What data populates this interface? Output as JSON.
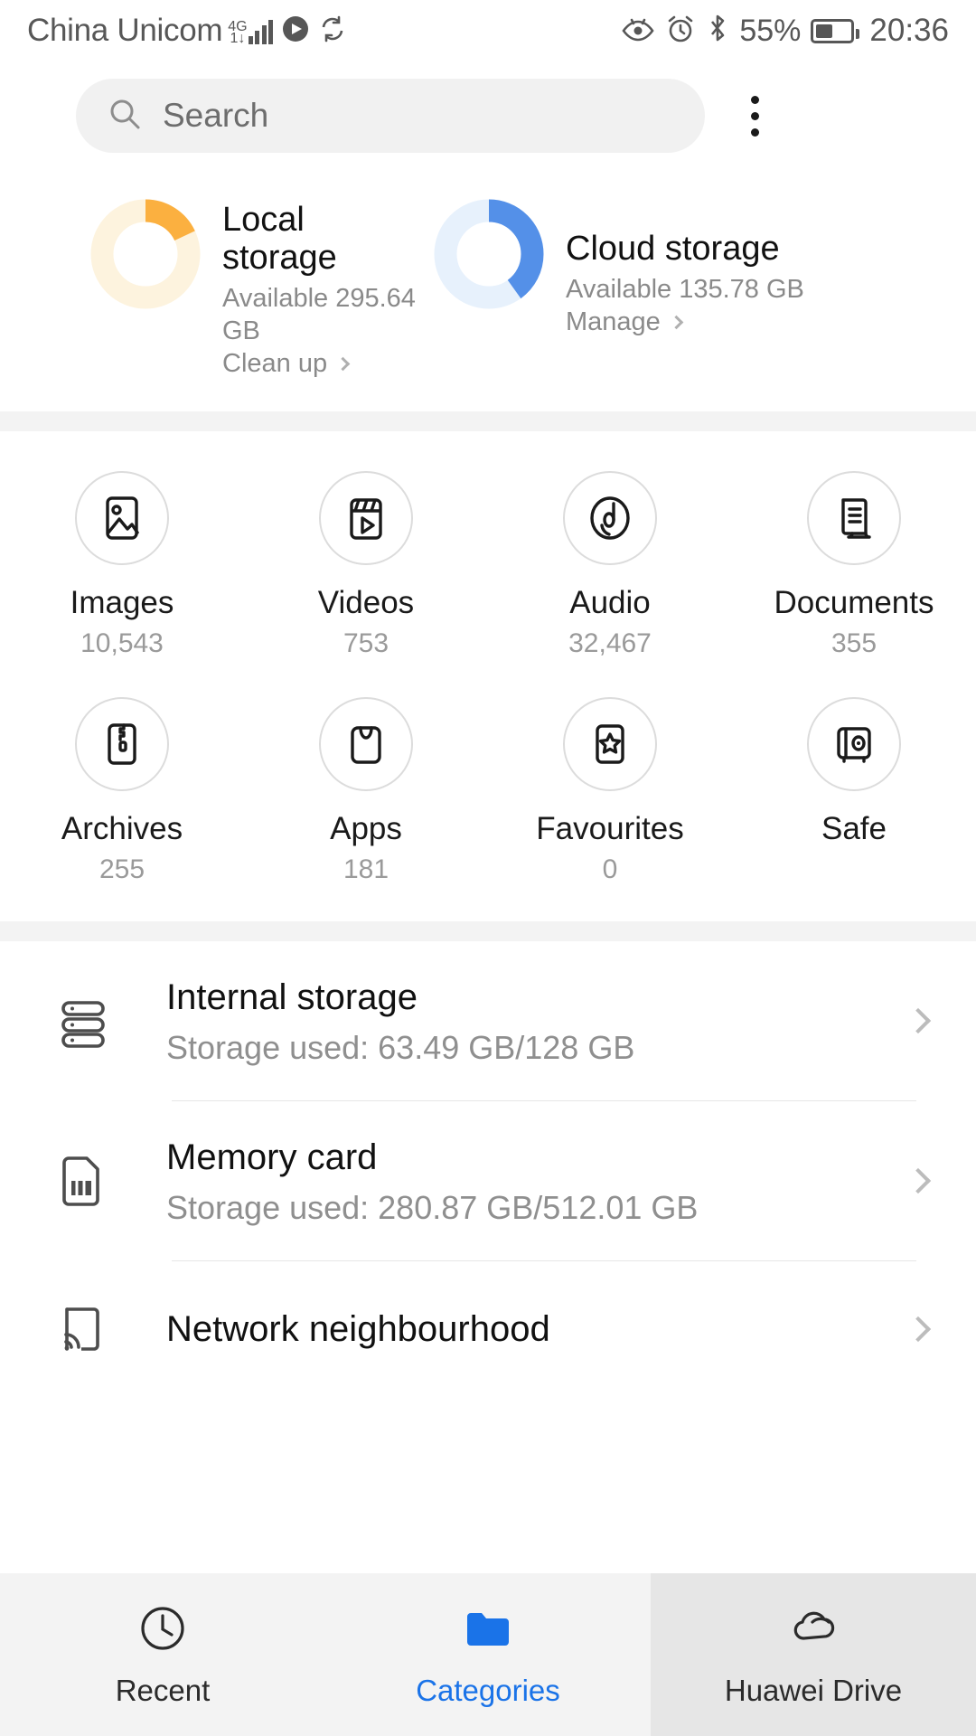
{
  "status_bar": {
    "carrier": "China Unicom",
    "network_gen": {
      "top": "4G",
      "bottom": "1↓"
    },
    "signal_bars": 4,
    "icons": [
      "play-badge-icon",
      "sync-icon",
      "eye-comfort-icon",
      "alarm-icon",
      "bluetooth-icon"
    ],
    "battery_percent": "55%",
    "battery_level": 55,
    "time": "20:36"
  },
  "search": {
    "placeholder": "Search",
    "icon": "search-icon"
  },
  "overflow_menu": {
    "icon": "more-vertical-icon"
  },
  "storage_summary": {
    "local": {
      "title": "Local storage",
      "available": "Available 295.64 GB",
      "action": "Clean up",
      "used_percent": 18,
      "color": "#fbb040",
      "track_color": "#fdf3de"
    },
    "cloud": {
      "title": "Cloud storage",
      "available": "Available 135.78 GB",
      "action": "Manage",
      "used_percent": 40,
      "color": "#5490e8",
      "track_color": "#e7f1fc"
    }
  },
  "categories": [
    {
      "label": "Images",
      "count": "10,543",
      "icon": "image-icon"
    },
    {
      "label": "Videos",
      "count": "753",
      "icon": "video-icon"
    },
    {
      "label": "Audio",
      "count": "32,467",
      "icon": "audio-disc-icon"
    },
    {
      "label": "Documents",
      "count": "355",
      "icon": "document-icon"
    },
    {
      "label": "Archives",
      "count": "255",
      "icon": "archive-zip-icon"
    },
    {
      "label": "Apps",
      "count": "181",
      "icon": "apps-bag-icon"
    },
    {
      "label": "Favourites",
      "count": "0",
      "icon": "favourite-star-icon"
    },
    {
      "label": "Safe",
      "count": "",
      "icon": "safe-vault-icon"
    }
  ],
  "storage_list": [
    {
      "title": "Internal storage",
      "subtitle": "Storage used: 63.49 GB/128 GB",
      "icon": "internal-storage-icon"
    },
    {
      "title": "Memory card",
      "subtitle": "Storage used: 280.87 GB/512.01 GB",
      "icon": "sd-card-icon"
    },
    {
      "title": "Network neighbourhood",
      "subtitle": "",
      "icon": "network-device-icon"
    }
  ],
  "bottom_nav": [
    {
      "label": "Recent",
      "icon": "clock-icon",
      "active": false
    },
    {
      "label": "Categories",
      "icon": "folder-icon",
      "active": true
    },
    {
      "label": "Huawei Drive",
      "icon": "cloud-icon",
      "active": false
    }
  ],
  "colors": {
    "accent": "#1a73e8",
    "local_orange": "#fbb040",
    "cloud_blue": "#5490e8"
  }
}
